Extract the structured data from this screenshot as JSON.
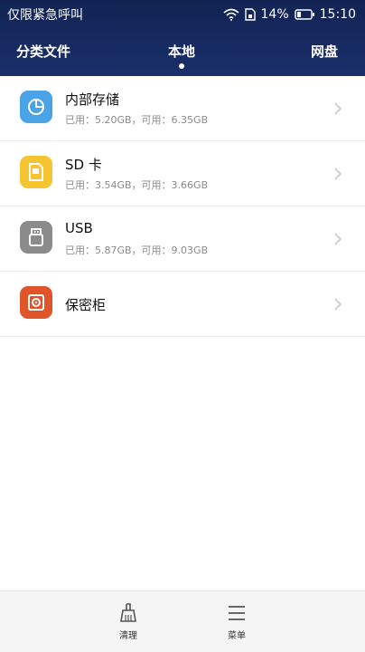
{
  "status": {
    "carrier": "仅限紧急呼叫",
    "battery": "14%",
    "time": "15:10"
  },
  "tabs": {
    "left": "分类文件",
    "center": "本地",
    "right": "网盘"
  },
  "storage": [
    {
      "title": "内部存储",
      "subtitle": "已用：5.20GB，可用：6.35GB",
      "icon": "pie-chart-icon",
      "color": "#4aa3e6"
    },
    {
      "title": "SD 卡",
      "subtitle": "已用：3.54GB，可用：3.66GB",
      "icon": "sd-card-icon",
      "color": "#f5c531"
    },
    {
      "title": "USB",
      "subtitle": "已用：5.87GB，可用：9.03GB",
      "icon": "usb-icon",
      "color": "#8b8b8b"
    },
    {
      "title": "保密柜",
      "subtitle": "",
      "icon": "safe-icon",
      "color": "#e0542a"
    }
  ],
  "bottom": {
    "clean": "清理",
    "menu": "菜单"
  },
  "colors": {
    "header_bg": "#142657",
    "accent_blue": "#4aa3e6",
    "accent_yellow": "#f5c531",
    "accent_gray": "#8b8b8b",
    "accent_red": "#e0542a"
  }
}
